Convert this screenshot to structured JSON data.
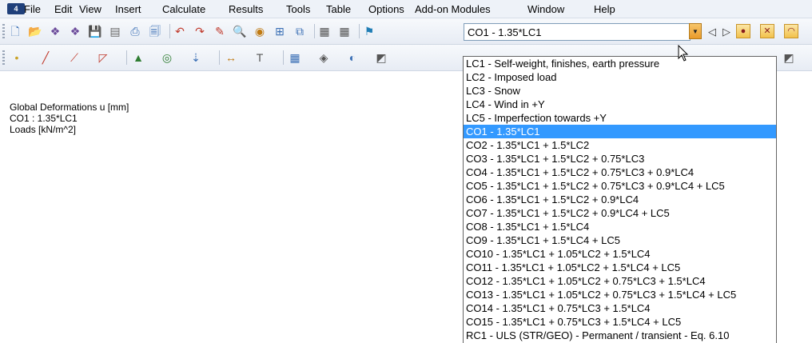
{
  "menu": {
    "app_icon": "app-logo-icon",
    "app_logo_text": "4",
    "items": [
      "File",
      "Edit",
      "View",
      "Insert",
      "Calculate",
      "Results",
      "Tools",
      "Table",
      "Options",
      "Add-on Modules",
      "Window",
      "Help"
    ]
  },
  "combo": {
    "selected": "CO1 - 1.35*LC1",
    "nav_prev": "◁",
    "nav_next": "▷"
  },
  "info": {
    "line1": "Global Deformations u [mm]",
    "line2": "CO1 : 1.35*LC1",
    "line3": "Loads [kN/m^2]"
  },
  "dropdown": {
    "selected_index": 5,
    "options": [
      "LC1 - Self-weight, finishes, earth pressure",
      "LC2 - Imposed load",
      "LC3 - Snow",
      "LC4 - Wind in +Y",
      "LC5 - Imperfection towards +Y",
      "CO1 - 1.35*LC1",
      "CO2 - 1.35*LC1 + 1.5*LC2",
      "CO3 - 1.35*LC1 + 1.5*LC2 + 0.75*LC3",
      "CO4 - 1.35*LC1 + 1.5*LC2 + 0.75*LC3 + 0.9*LC4",
      "CO5 - 1.35*LC1 + 1.5*LC2 + 0.75*LC3 + 0.9*LC4 + LC5",
      "CO6 - 1.35*LC1 + 1.5*LC2 + 0.9*LC4",
      "CO7 - 1.35*LC1 + 1.5*LC2 + 0.9*LC4 + LC5",
      "CO8 - 1.35*LC1 + 1.5*LC4",
      "CO9 - 1.35*LC1 + 1.5*LC4 + LC5",
      "CO10 - 1.35*LC1 + 1.05*LC2 + 1.5*LC4",
      "CO11 - 1.35*LC1 + 1.05*LC2 + 1.5*LC4 + LC5",
      "CO12 - 1.35*LC1 + 1.05*LC2 + 0.75*LC3 + 1.5*LC4",
      "CO13 - 1.35*LC1 + 1.05*LC2 + 0.75*LC3 + 1.5*LC4 + LC5",
      "CO14 - 1.35*LC1 + 0.75*LC3 + 1.5*LC4",
      "CO15 - 1.35*LC1 + 0.75*LC3 + 1.5*LC4 + LC5",
      "RC1 - ULS (STR/GEO) - Permanent / transient - Eq. 6.10"
    ]
  },
  "toolbar1_icons": [
    "new-file-icon",
    "open-folder-icon",
    "open-template-icon",
    "open-template2-icon",
    "save-icon",
    "print-icon",
    "print-preview-icon",
    "print-report-icon",
    "undo-icon",
    "redo-icon",
    "edit-node-icon",
    "zoom-icon",
    "render-icon",
    "insert-icon",
    "view-icon",
    "table-icon",
    "table2-icon",
    "load-case-icon"
  ],
  "toolbar2_icons": [
    "node-icon",
    "line-icon",
    "member-icon",
    "surface-icon",
    "support-icon",
    "hinge-icon",
    "load-icon",
    "dimension-icon",
    "text-icon",
    "grid-icon",
    "select-icon",
    "display-icon",
    "view3d-icon"
  ],
  "toolbar1_right_icons": [
    "results-icon",
    "results-values-icon",
    "results-deform-icon"
  ],
  "colors": {
    "accent": "#3399ff",
    "menubar": "#eef2f8",
    "combo_arrow": "#e99a2a"
  }
}
